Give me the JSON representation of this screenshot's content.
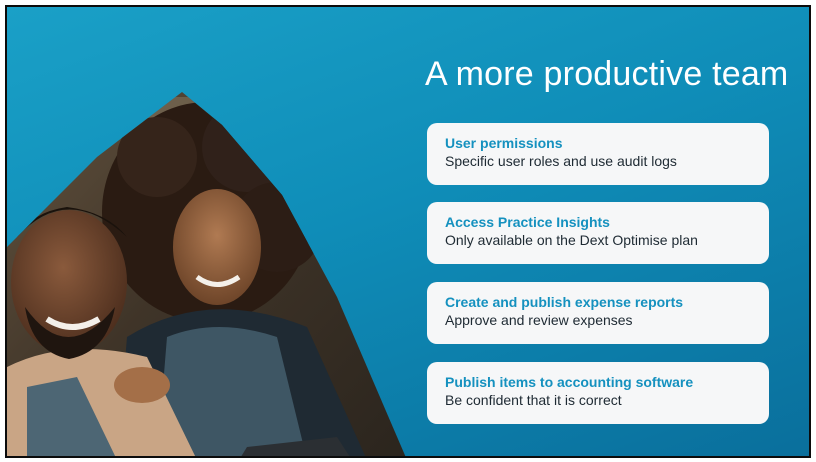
{
  "slide": {
    "headline": "A more productive team",
    "colors": {
      "background": "#1198c2",
      "card": "#f6f7f8",
      "card_title": "#1591bf",
      "card_text": "#1e2a33"
    },
    "cards": [
      {
        "title": "User permissions",
        "description": "Specific user roles and use audit logs"
      },
      {
        "title": "Access Practice Insights",
        "description": "Only available on the Dext Optimise plan"
      },
      {
        "title": "Create and publish expense reports",
        "description": "Approve and review expenses"
      },
      {
        "title": "Publish items to accounting software",
        "description": "Be confident that it is correct"
      }
    ]
  }
}
